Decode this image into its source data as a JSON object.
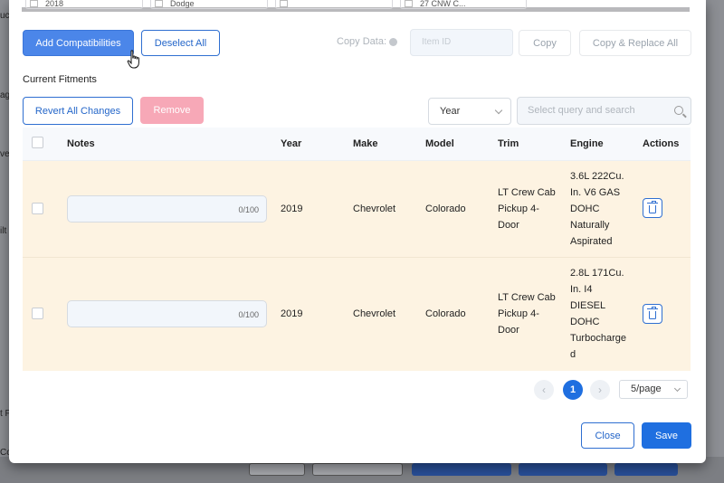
{
  "background": {
    "left_fragments": [
      "uc",
      "ag",
      "ve",
      "ilt",
      "t F",
      "Co"
    ]
  },
  "top_fragments": {
    "field_1": "2018",
    "field_2": "Dodge",
    "field_3": "27 CNW C..."
  },
  "toolbar": {
    "add_compatibilities_label": "Add Compatibilities",
    "deselect_all_label": "Deselect All",
    "copy_data_label": "Copy Data:",
    "item_id_placeholder": "Item ID",
    "copy_label": "Copy",
    "copy_replace_label": "Copy & Replace All"
  },
  "current_fitments": {
    "title": "Current Fitments",
    "revert_label": "Revert All Changes",
    "remove_label": "Remove",
    "filter_selected": "Year",
    "search_placeholder": "Select query and search"
  },
  "table": {
    "columns": {
      "notes": "Notes",
      "year": "Year",
      "make": "Make",
      "model": "Model",
      "trim": "Trim",
      "engine": "Engine",
      "actions": "Actions"
    },
    "rows": [
      {
        "notes_counter": "0/100",
        "year": "2019",
        "make": "Chevrolet",
        "model": "Colorado",
        "trim": [
          "LT Crew Cab",
          "Pickup 4-",
          "Door"
        ],
        "engine": [
          "3.6L 222Cu.",
          "In. V6 GAS",
          "DOHC",
          "Naturally",
          "Aspirated"
        ]
      },
      {
        "notes_counter": "0/100",
        "year": "2019",
        "make": "Chevrolet",
        "model": "Colorado",
        "trim": [
          "LT Crew Cab",
          "Pickup 4-",
          "Door"
        ],
        "engine": [
          "2.8L 171Cu.",
          "In. I4",
          "DIESEL",
          "DOHC",
          "Turbocharge",
          "d"
        ]
      }
    ]
  },
  "pagination": {
    "prev_icon": "‹",
    "next_icon": "›",
    "current_page": "1",
    "page_size": "5/page"
  },
  "footer": {
    "close_label": "Close",
    "save_label": "Save"
  },
  "colors": {
    "primary": "#1f6fe0",
    "row_highlight": "#fdf3e2",
    "remove_disabled": "#f7a8b7"
  }
}
